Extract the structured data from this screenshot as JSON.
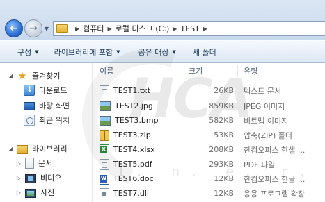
{
  "address_bar": {
    "back_icon": "back-arrow-icon",
    "forward_icon": "forward-arrow-icon",
    "breadcrumbs": [
      "컴퓨터",
      "로컬 디스크 (C:)",
      "TEST"
    ]
  },
  "command_bar": {
    "organize": "구성",
    "add_to_library": "라이브러리에 포함",
    "share_with": "공유 대상",
    "new_folder": "새 폴더"
  },
  "nav_pane": {
    "favorites": {
      "label": "즐겨찾기",
      "items": [
        "다운로드",
        "바탕 화면",
        "최근 위치"
      ]
    },
    "libraries": {
      "label": "라이브러리",
      "items": [
        "문서",
        "비디오",
        "사진"
      ]
    }
  },
  "file_list": {
    "columns": {
      "name": "이름",
      "size": "크기",
      "type": "유형"
    },
    "rows": [
      {
        "name": "TEST1.txt",
        "size": "26KB",
        "type": "텍스트 문서",
        "icon": "text-file-icon"
      },
      {
        "name": "TEST2.jpg",
        "size": "859KB",
        "type": "JPEG 이미지",
        "icon": "jpeg-image-icon"
      },
      {
        "name": "TEST3.bmp",
        "size": "582KB",
        "type": "비트맵 이미지",
        "icon": "bitmap-image-icon"
      },
      {
        "name": "TEST3.zip",
        "size": "53KB",
        "type": "압축(ZIP) 폴더",
        "icon": "zip-folder-icon"
      },
      {
        "name": "TEST4.xlsx",
        "size": "208KB",
        "type": "한컴오피스 한셀 ...",
        "icon": "spreadsheet-file-icon"
      },
      {
        "name": "TEST5.pdf",
        "size": "293KB",
        "type": "PDF 파일",
        "icon": "pdf-file-icon"
      },
      {
        "name": "TEST6.doc",
        "size": "12KB",
        "type": "한컴오피스 한글 ...",
        "icon": "word-document-icon"
      },
      {
        "name": "TEST7.dll",
        "size": "12KB",
        "type": "응용 프로그램 확장",
        "icon": "dll-file-icon"
      }
    ]
  },
  "watermark": {
    "main": "HCA",
    "sub": "I.  n.  e.  r.  n"
  }
}
